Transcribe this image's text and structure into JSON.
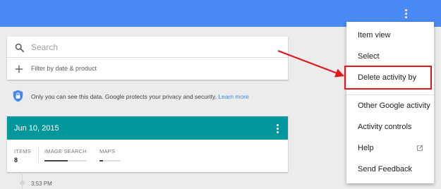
{
  "appbar": {
    "more_icon": "more-vert-icon",
    "color": "#4a8af4"
  },
  "search": {
    "placeholder": "Search",
    "value": "",
    "icon": "search-icon",
    "filter_icon": "plus-icon",
    "filter_label": "Filter by date & product"
  },
  "privacy": {
    "icon": "shield-lock-icon",
    "text": "Only you can see this data. Google protects your privacy and security.",
    "link": "Learn more"
  },
  "day_card": {
    "date": "Jun 10, 2015",
    "header_color": "#00979d",
    "stats": {
      "items_label": "ITEMS",
      "items_count": "8",
      "image_search_label": "IMAGE SEARCH",
      "image_search_fraction": 0.55,
      "maps_label": "MAPS",
      "maps_fraction": 0.15
    }
  },
  "timeline": {
    "time": "3:53 PM"
  },
  "menu": {
    "items": [
      {
        "label": "Item view"
      },
      {
        "label": "Select"
      },
      {
        "label": "Delete activity by"
      },
      {
        "label": "Other Google activity"
      },
      {
        "label": "Activity controls"
      },
      {
        "label": "Help",
        "icon": "launch-icon"
      },
      {
        "label": "Send Feedback"
      }
    ],
    "highlighted": "Delete activity by"
  },
  "annotation": {
    "color": "#e0181b"
  }
}
